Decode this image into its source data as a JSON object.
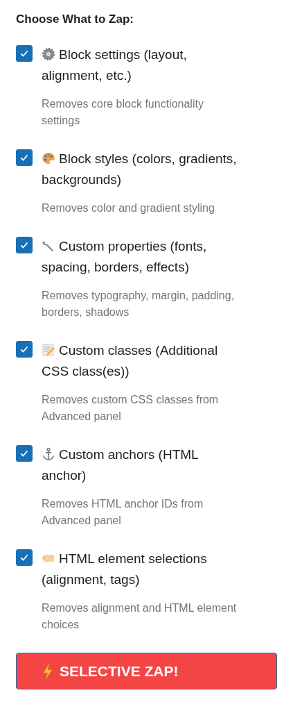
{
  "heading": "Choose What to Zap:",
  "options": [
    {
      "label": "Block settings (layout, alignment, etc.)",
      "description": "Removes core block functionality settings",
      "checked": true
    },
    {
      "label": "Block styles (colors, gradients, backgrounds)",
      "description": "Removes color and gradient styling",
      "checked": true
    },
    {
      "label": "Custom properties (fonts, spacing, borders, effects)",
      "description": "Removes typography, margin, padding, borders, shadows",
      "checked": true
    },
    {
      "label": "Custom classes (Additional CSS class(es))",
      "description": "Removes custom CSS classes from Advanced panel",
      "checked": true
    },
    {
      "label": "Custom anchors (HTML anchor)",
      "description": "Removes HTML anchor IDs from Advanced panel",
      "checked": true
    },
    {
      "label": "HTML element selections (alignment, tags)",
      "description": "Removes alignment and HTML element choices",
      "checked": true
    }
  ],
  "button": {
    "label": "SELECTIVE ZAP!"
  }
}
